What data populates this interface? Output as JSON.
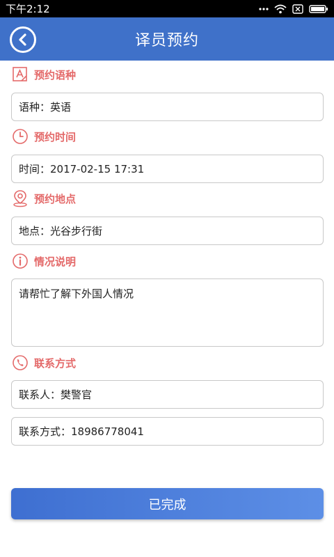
{
  "status_bar": {
    "time": "下午2:12"
  },
  "header": {
    "title": "译员预约"
  },
  "sections": {
    "language": {
      "label": "预约语种",
      "field": "语种：英语"
    },
    "time": {
      "label": "预约时间",
      "field": "时间：2017-02-15 17:31"
    },
    "location": {
      "label": "预约地点",
      "field": "地点：光谷步行街"
    },
    "description": {
      "label": "情况说明",
      "field": "请帮忙了解下外国人情况"
    },
    "contact": {
      "label": "联系方式",
      "person": "联系人：樊警官",
      "phone": "联系方式：18986778041"
    }
  },
  "submit": {
    "label": "已完成"
  },
  "colors": {
    "header": "#3f71c9",
    "accent": "#e46a6a",
    "button": "#4a7bd8"
  },
  "icons": [
    "back-arrow-icon",
    "language-icon",
    "clock-icon",
    "location-pin-icon",
    "info-icon",
    "phone-icon",
    "wifi-icon",
    "battery-icon"
  ]
}
